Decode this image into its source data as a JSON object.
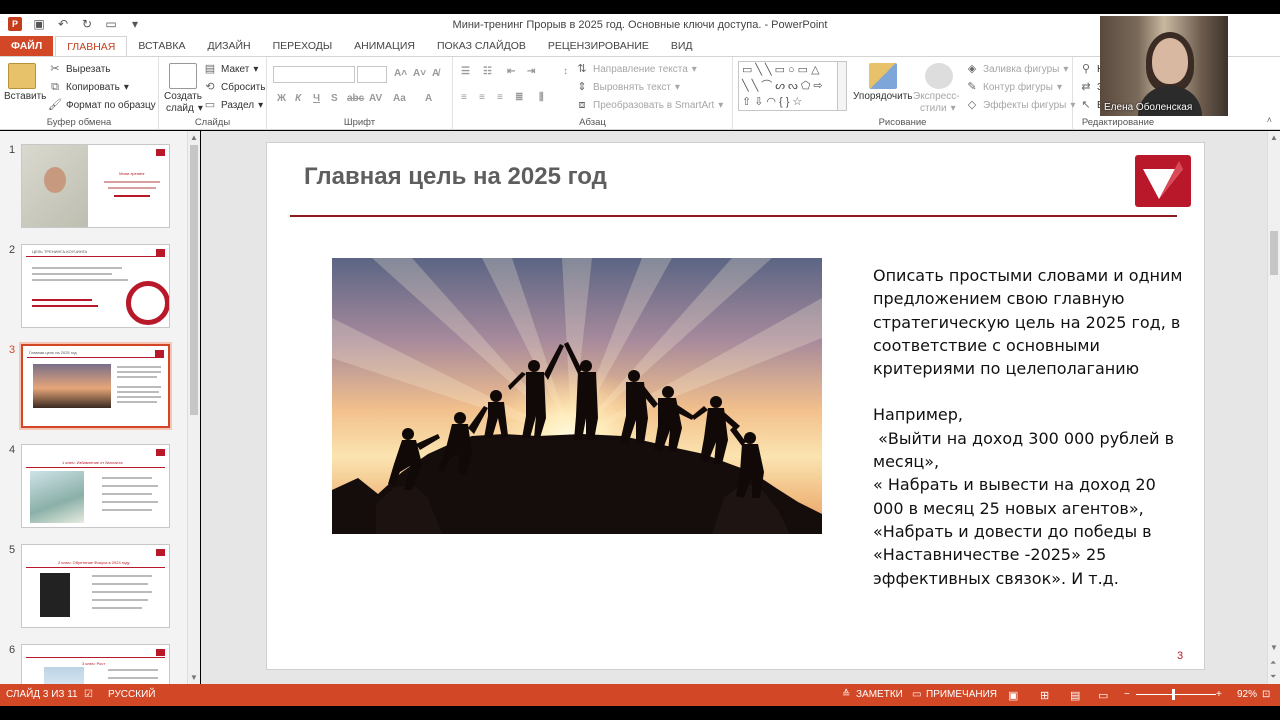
{
  "window": {
    "title": "Мини-тренинг Прорыв в 2025 год. Основные ключи доступа. - PowerPoint",
    "app_icon": "P"
  },
  "tabs": [
    "ФАЙЛ",
    "ГЛАВНАЯ",
    "ВСТАВКА",
    "ДИЗАЙН",
    "ПЕРЕХОДЫ",
    "АНИМАЦИЯ",
    "ПОКАЗ СЛАЙДОВ",
    "РЕЦЕНЗИРОВАНИЕ",
    "ВИД"
  ],
  "active_tab": "ГЛАВНАЯ",
  "ribbon": {
    "clipboard": {
      "paste": "Вставить",
      "cut": "Вырезать",
      "copy": "Копировать",
      "format_painter": "Формат по образцу",
      "label": "Буфер обмена"
    },
    "slides": {
      "new_slide_line1": "Создать",
      "new_slide_line2": "слайд",
      "layout": "Макет",
      "reset": "Сбросить",
      "section": "Раздел",
      "label": "Слайды"
    },
    "font": {
      "label": "Шрифт",
      "buttons": [
        "Ж",
        "К",
        "Ч",
        "S",
        "abc",
        "AV",
        "Aa",
        "A"
      ]
    },
    "paragraph": {
      "text_direction": "Направление текста",
      "align_text": "Выровнять текст",
      "smartart": "Преобразовать в SmartArt",
      "label": "Абзац"
    },
    "drawing": {
      "arrange": "Упорядочить",
      "quick_styles_line1": "Экспресс-",
      "quick_styles_line2": "стили",
      "fill": "Заливка фигуры",
      "outline": "Контур фигуры",
      "effects": "Эффекты фигуры",
      "label": "Рисование"
    },
    "editing": {
      "label": "Редактирование",
      "items": [
        "Н",
        "З",
        "В"
      ]
    }
  },
  "webcam": {
    "name": "Елена Оболенская"
  },
  "thumbnails": [
    {
      "num": "1",
      "title": "Мини-тренинг"
    },
    {
      "num": "2",
      "title": "ЦЕЛЬ ТРЕНИНГА-КОУЧИНГА"
    },
    {
      "num": "3",
      "title": "Главная цель на 2025 год"
    },
    {
      "num": "4",
      "title": "1 ключ: Избавление от балласта"
    },
    {
      "num": "5",
      "title": "2 ключ: Обретение Фокуса в 2024 году"
    },
    {
      "num": "6",
      "title": "3 ключ: Рост"
    }
  ],
  "selected_slide": 3,
  "slide": {
    "title": "Главная цель на 2025 год",
    "paragraph1": "Описать простыми словами и одним предложением свою главную стратегическую цель на 2025 год, в соответствие с основными критериями по целеполаганию",
    "paragraph2": "Например,\n «Выйти на доход 300 000 рублей в месяц»,\n« Набрать и вывести на доход 20 000 в месяц 25 новых агентов»,\n«Набрать и довести до победы в «Наставничестве -2025» 25 эффективных связок». И т.д.",
    "number": "3"
  },
  "status": {
    "slide_info": "СЛАЙД 3 ИЗ 11",
    "language": "РУССКИЙ",
    "notes": "ЗАМЕТКИ",
    "comments": "ПРИМЕЧАНИЯ",
    "zoom": "92%",
    "zoom_minus": "−",
    "zoom_plus": "+"
  },
  "colors": {
    "accent": "#d24726",
    "brand_red": "#b8182a",
    "title_gray": "#5e5e5e",
    "rule": "#8b1a1a"
  }
}
